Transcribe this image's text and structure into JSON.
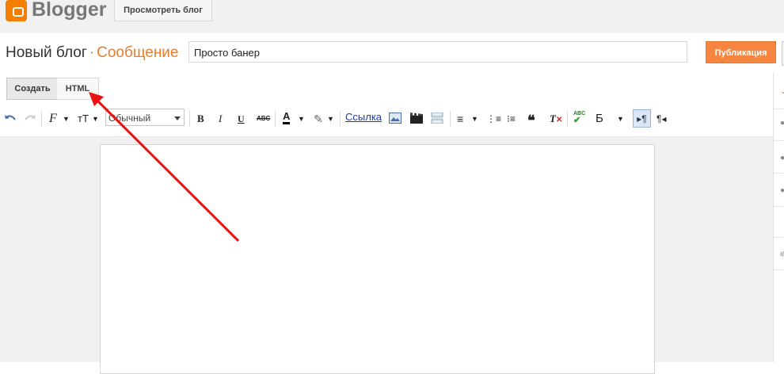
{
  "topbar": {
    "brand": "Blogger",
    "view_blog_button": "Просмотреть блог"
  },
  "header": {
    "blog_name": "Новый блог",
    "separator": "·",
    "section": "Сообщение",
    "post_title_value": "Просто банер",
    "publish_button": "Публикация"
  },
  "mode_tabs": [
    {
      "label": "Создать"
    },
    {
      "label": "HTML"
    }
  ],
  "toolbar": {
    "font_select_value": "Обычный",
    "link_label": "Ссылка",
    "bold": "B",
    "italic": "I",
    "underline": "U",
    "strike": "ABC",
    "text_color": "A",
    "font": "F",
    "size": "тТ",
    "quote": "❝",
    "spell": "ABC",
    "lang": "Б",
    "ltr": "▸¶",
    "rtl": "¶◂"
  },
  "colors": {
    "accent": "#e67d30",
    "publish": "#f5853f",
    "arrow": "#ee1111"
  },
  "icons": [
    "blogger-logo-icon",
    "undo-icon",
    "redo-icon",
    "image-icon",
    "video-icon",
    "jump-break-icon",
    "align-icon",
    "numbered-list-icon",
    "bullet-list-icon",
    "quote-icon",
    "clear-format-icon",
    "spellcheck-icon",
    "ltr-icon",
    "rtl-icon"
  ]
}
